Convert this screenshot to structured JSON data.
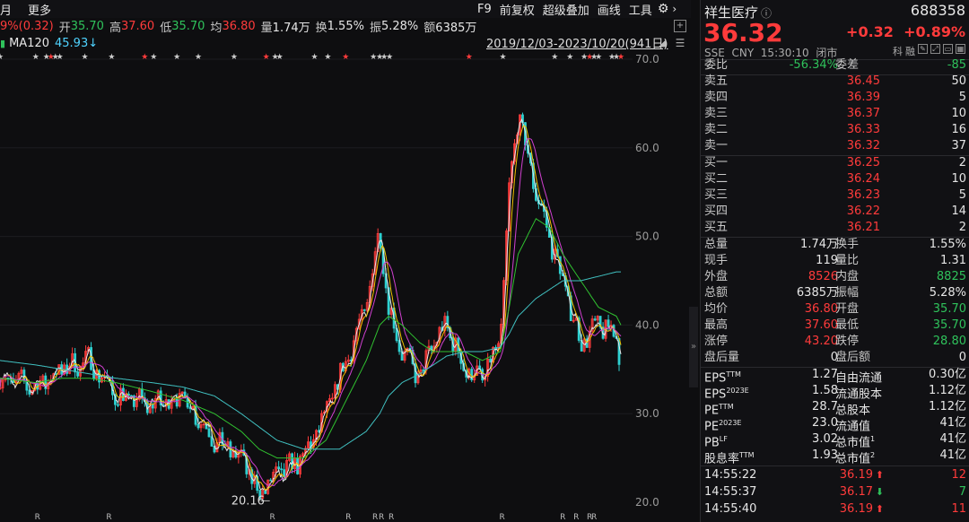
{
  "toolbar": {
    "month": "月",
    "more": "更多",
    "chg_partial": "9%(0.32)",
    "open_label": "开",
    "open_value": "35.70",
    "high_label": "高",
    "high_value": "37.60",
    "low_label": "低",
    "low_value": "35.70",
    "avg_label": "均",
    "avg_value": "36.80",
    "vol_label": "量",
    "vol_value": "1.74万",
    "turn_label": "换",
    "turn_value": "1.55%",
    "amp_label": "振",
    "amp_value": "5.28%",
    "amt_label": "额",
    "amt_value": "6385万",
    "f9": "F9",
    "adjust": "前复权",
    "overlay": "超级叠加",
    "draw": "画线",
    "tools": "工具",
    "gear_icon": "gear-icon"
  },
  "ma": {
    "label": "MA120",
    "value": "45.93",
    "arrow": "↓"
  },
  "date_range": "2019/12/03-2023/10/20(941日)",
  "chart_data": {
    "type": "line",
    "title": "",
    "y_ticks": [
      "70.0",
      "60.0",
      "50.0",
      "40.0",
      "30.0"
    ],
    "y_tick_values": [
      70,
      60,
      50,
      40,
      30
    ],
    "ylim": [
      19.5,
      71
    ],
    "min_label": "20.16",
    "min_label_value": 20.16,
    "ma120_value": 45.93,
    "colors": {
      "price": "#ff3b3b",
      "ma5": "#e8e8e8",
      "ma10": "#f0c000",
      "ma20": "#d040d0",
      "ma60": "#30c030",
      "ma120": "#40c0c0"
    },
    "x_index": [
      0,
      40,
      70,
      100,
      130,
      170,
      205,
      240,
      270,
      290,
      310,
      340,
      365,
      380,
      395,
      410,
      425,
      435,
      450,
      470,
      485,
      500,
      520,
      540,
      560,
      570,
      580,
      600,
      615,
      630,
      650,
      670,
      690,
      695
    ],
    "price": [
      34,
      33,
      35,
      36,
      32,
      31,
      32,
      27,
      25,
      21,
      23,
      25,
      30,
      34,
      38,
      42,
      51,
      42,
      37,
      34,
      38,
      40,
      35,
      34,
      38,
      55,
      64,
      55,
      50,
      45,
      38,
      40,
      39,
      36
    ],
    "ma60": [
      34,
      33.5,
      34,
      34,
      33.5,
      32.5,
      31.5,
      30,
      28,
      26,
      25,
      25,
      27,
      30,
      33,
      36,
      40,
      41,
      40,
      38,
      37,
      37,
      37,
      36,
      37,
      42,
      48,
      52,
      51,
      48,
      45,
      42,
      41,
      40
    ],
    "ma120": [
      36,
      35.5,
      35,
      34.5,
      34,
      33.5,
      33,
      32,
      30,
      28.5,
      27,
      26,
      26,
      26,
      27,
      28,
      30,
      32,
      33.5,
      34.5,
      35.5,
      36.5,
      37,
      37,
      37.5,
      39,
      41,
      43,
      44,
      45,
      45,
      45.5,
      46,
      46
    ],
    "event_markers_top": [
      0,
      40,
      52,
      57,
      62,
      67,
      95,
      125,
      162,
      172,
      198,
      222,
      262,
      298,
      308,
      313,
      352,
      367,
      387,
      418,
      425,
      430,
      436,
      525,
      563,
      621,
      638,
      654,
      660,
      665,
      670,
      685,
      690,
      695
    ],
    "event_markers_bottom": [
      42,
      122,
      305,
      390,
      420,
      427,
      438,
      562,
      630,
      645,
      660,
      665
    ]
  },
  "panel": {
    "name": "祥生医疗",
    "info_icon": "info-icon",
    "code": "688358",
    "price": "36.32",
    "chg": "+0.32",
    "chg_pct": "+0.89%",
    "exchange": "SSE",
    "currency": "CNY",
    "time": "15:30:10",
    "status": "闭市",
    "icon_labels": [
      "科",
      "融"
    ],
    "bid_ratio_label": "委比",
    "bid_ratio": "-56.34%",
    "bid_diff_label": "委差",
    "bid_diff": "-85",
    "asks": [
      {
        "label": "卖五",
        "price": "36.45",
        "qty": "50"
      },
      {
        "label": "卖四",
        "price": "36.39",
        "qty": "5"
      },
      {
        "label": "卖三",
        "price": "36.37",
        "qty": "10"
      },
      {
        "label": "卖二",
        "price": "36.33",
        "qty": "16"
      },
      {
        "label": "卖一",
        "price": "36.32",
        "qty": "37"
      }
    ],
    "bids": [
      {
        "label": "买一",
        "price": "36.25",
        "qty": "2"
      },
      {
        "label": "买二",
        "price": "36.24",
        "qty": "10"
      },
      {
        "label": "买三",
        "price": "36.23",
        "qty": "5"
      },
      {
        "label": "买四",
        "price": "36.22",
        "qty": "14"
      },
      {
        "label": "买五",
        "price": "36.21",
        "qty": "2"
      }
    ],
    "stats": [
      {
        "l1": "总量",
        "v1": "1.74万",
        "c1": "white",
        "l2": "换手",
        "v2": "1.55%",
        "c2": "white"
      },
      {
        "l1": "现手",
        "v1": "119",
        "c1": "white",
        "l2": "量比",
        "v2": "1.31",
        "c2": "white"
      },
      {
        "l1": "外盘",
        "v1": "8526",
        "c1": "red",
        "l2": "内盘",
        "v2": "8825",
        "c2": "green"
      },
      {
        "l1": "总额",
        "v1": "6385万",
        "c1": "white",
        "l2": "振幅",
        "v2": "5.28%",
        "c2": "white"
      },
      {
        "l1": "均价",
        "v1": "36.80",
        "c1": "red",
        "l2": "开盘",
        "v2": "35.70",
        "c2": "green"
      },
      {
        "l1": "最高",
        "v1": "37.60",
        "c1": "red",
        "l2": "最低",
        "v2": "35.70",
        "c2": "green"
      },
      {
        "l1": "涨停",
        "v1": "43.20",
        "c1": "red",
        "l2": "跌停",
        "v2": "28.80",
        "c2": "green"
      },
      {
        "l1": "盘后量",
        "v1": "0",
        "c1": "white",
        "l2": "盘后额",
        "v2": "0",
        "c2": "white"
      }
    ],
    "fund": [
      {
        "l1": "EPS",
        "s1": "TTM",
        "v1": "1.27",
        "l2": "自由流通",
        "s2": "",
        "v2": "0.30亿"
      },
      {
        "l1": "EPS",
        "s1": "2023E",
        "v1": "1.58",
        "l2": "流通股本",
        "s2": "",
        "v2": "1.12亿"
      },
      {
        "l1": "PE",
        "s1": "TTM",
        "v1": "28.7",
        "l2": "总股本",
        "s2": "",
        "v2": "1.12亿"
      },
      {
        "l1": "PE",
        "s1": "2023E",
        "v1": "23.0",
        "l2": "流通值",
        "s2": "",
        "v2": "41亿"
      },
      {
        "l1": "PB",
        "s1": "LF",
        "v1": "3.02",
        "l2": "总市值",
        "s2": "1",
        "v2": "41亿"
      },
      {
        "l1": "股息率",
        "s1": "TTM",
        "v1": "1.93",
        "l2": "总市值",
        "s2": "2",
        "v2": "41亿"
      }
    ],
    "ticks": [
      {
        "time": "14:55:22",
        "price": "36.19",
        "dir": "up",
        "vol": "12"
      },
      {
        "time": "14:55:37",
        "price": "36.17",
        "dir": "down",
        "vol": "7"
      },
      {
        "time": "14:55:40",
        "price": "36.19",
        "dir": "up",
        "vol": "11"
      }
    ]
  }
}
